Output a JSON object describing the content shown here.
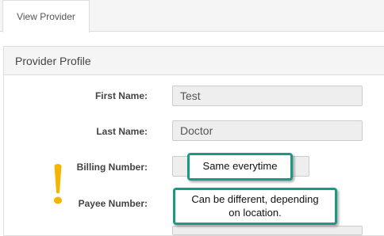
{
  "tabs": [
    {
      "label": "View Provider"
    }
  ],
  "panel": {
    "title": "Provider Profile"
  },
  "fields": {
    "first_name": {
      "label": "First Name:",
      "value": "Test"
    },
    "last_name": {
      "label": "Last Name:",
      "value": "Doctor"
    },
    "billing_number": {
      "label": "Billing Number:",
      "value": ""
    },
    "payee_number": {
      "label": "Payee Number:",
      "value": ""
    }
  },
  "callouts": {
    "billing": "Same everytime",
    "payee": "Can be different, depending on location."
  },
  "colors": {
    "callout_border": "#1a9a83",
    "exclamation": "#f5b400"
  },
  "icons": {
    "warning": "exclamation-icon"
  }
}
